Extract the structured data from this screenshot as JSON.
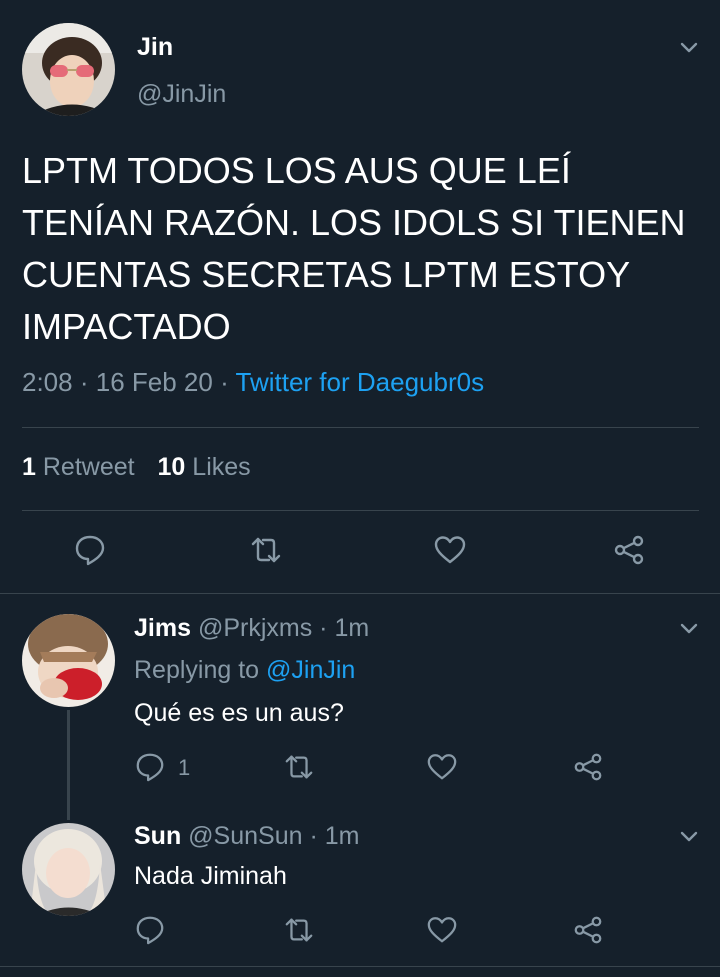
{
  "main_tweet": {
    "author_name": "Jin",
    "author_handle": "@JinJin",
    "text": "LPTM TODOS LOS AUS QUE LEÍ TENÍAN RAZÓN. LOS IDOLS SI TIENEN CUENTAS SECRETAS LPTM ESTOY IMPACTADO",
    "time": "2:08",
    "separator": "·",
    "date": "16 Feb 20",
    "source": "Twitter for Daegubr0s",
    "retweet_count": "1",
    "retweet_label": "Retweet",
    "like_count": "10",
    "like_label": "Likes"
  },
  "replies": [
    {
      "author_name": "Jims",
      "author_handle": "@Prkjxms",
      "separator": "·",
      "time": "1m",
      "replying_prefix": "Replying to",
      "replying_to": "@JinJin",
      "text": "Qué es es un aus?",
      "reply_count": "1"
    },
    {
      "author_name": "Sun",
      "author_handle": "@SunSun",
      "separator": "·",
      "time": "1m",
      "text": "Nada Jiminah",
      "reply_count": ""
    }
  ],
  "icons": {
    "reply": "reply-icon",
    "retweet": "retweet-icon",
    "like": "heart-icon",
    "share": "share-icon",
    "more": "chevron-down-icon"
  },
  "colors": {
    "background": "#15202b",
    "text": "#ffffff",
    "secondary": "#8899a6",
    "accent": "#1da1f2",
    "divider": "#38444d"
  }
}
